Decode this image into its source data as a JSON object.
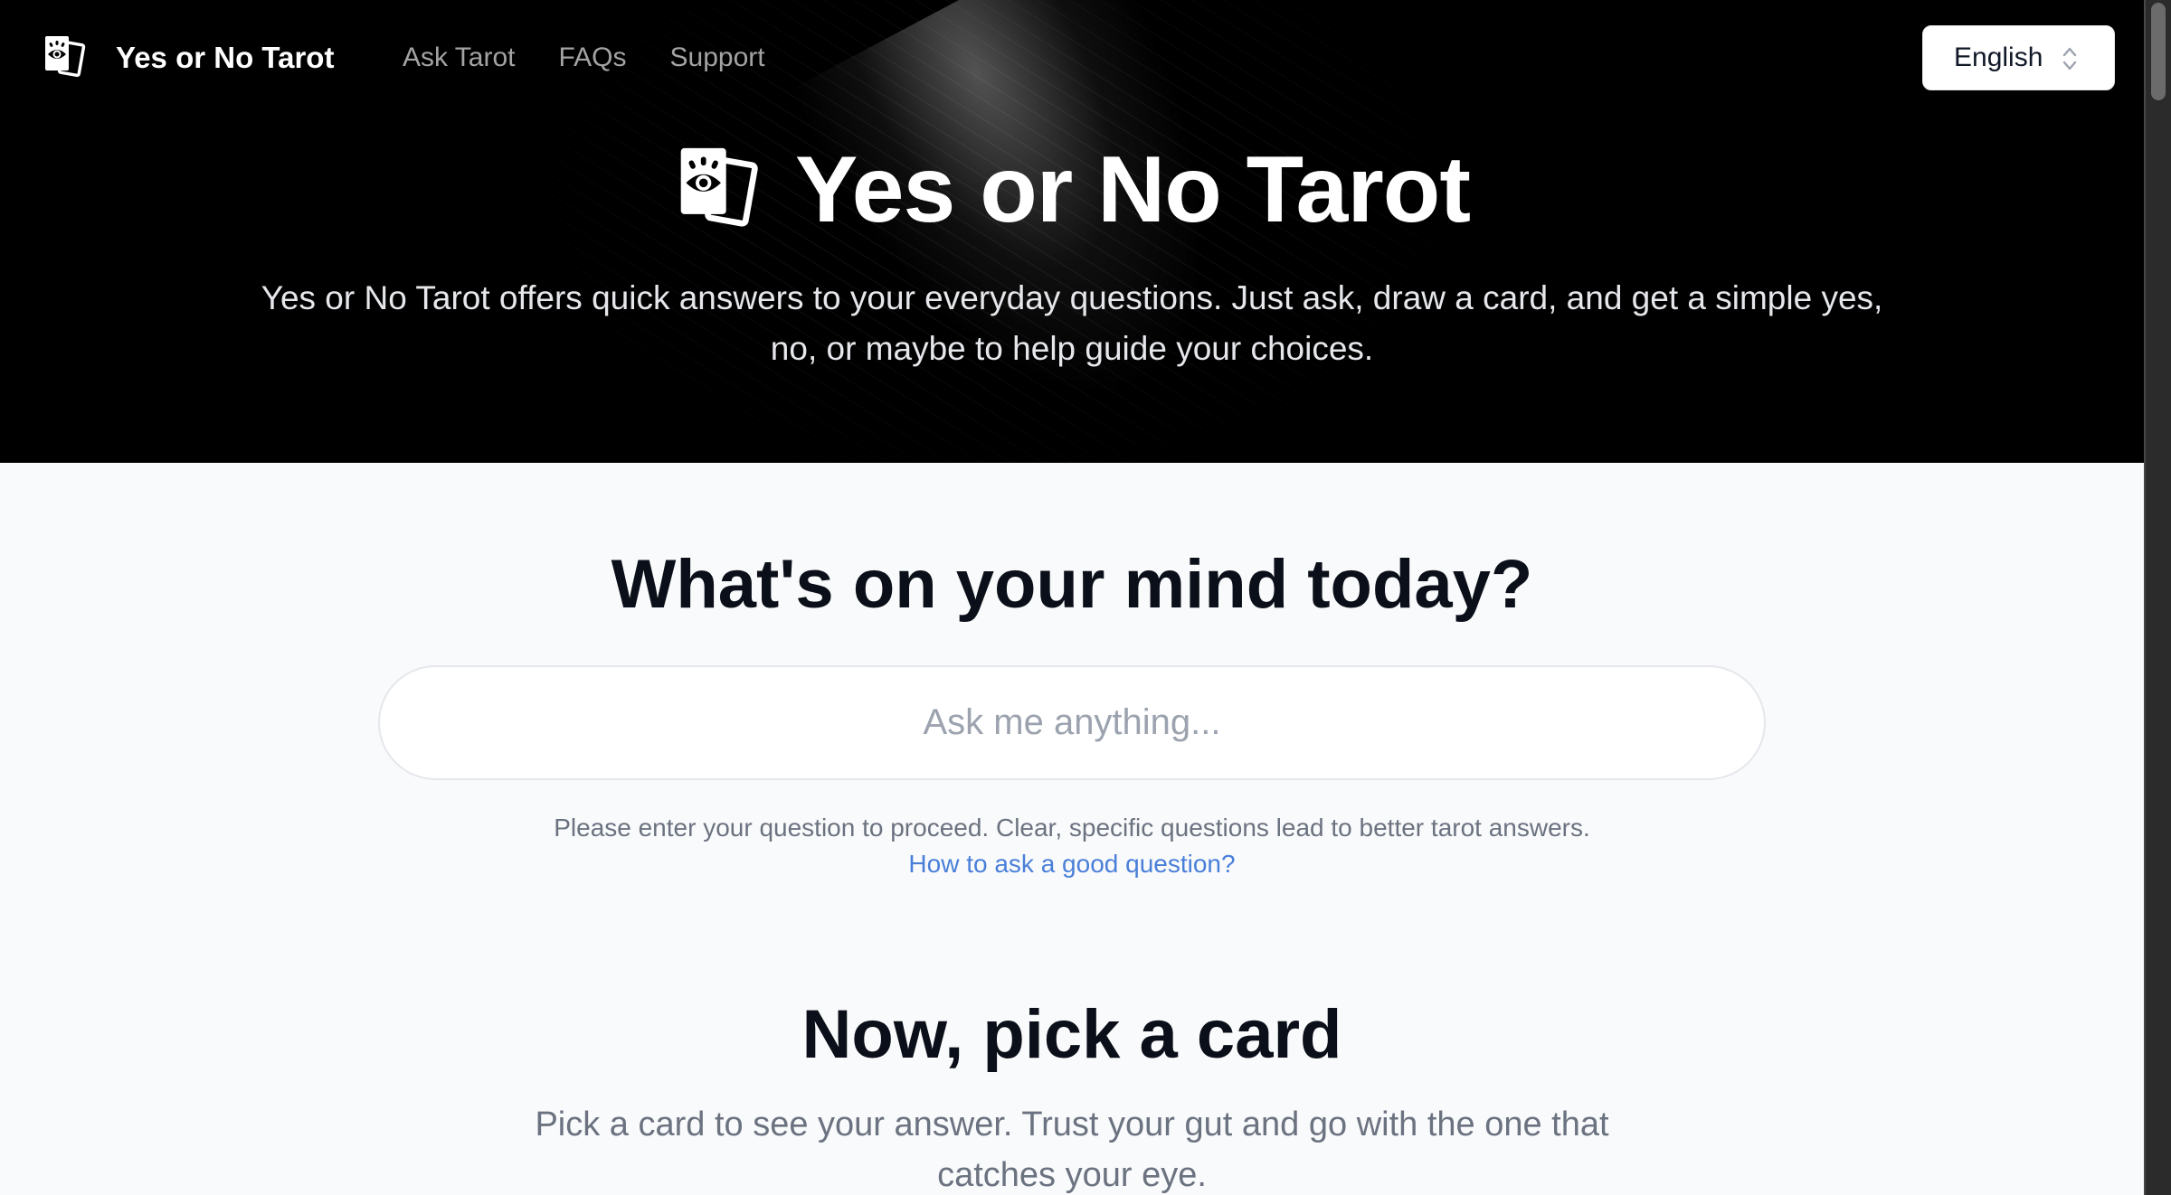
{
  "nav": {
    "brand_name": "Yes or No Tarot",
    "brand_icon": "tarot-cards-eye-icon",
    "links": [
      {
        "label": "Ask Tarot"
      },
      {
        "label": "FAQs"
      },
      {
        "label": "Support"
      }
    ],
    "language": {
      "selected": "English",
      "icon": "chevron-up-down-icon"
    }
  },
  "hero": {
    "title": "Yes or No Tarot",
    "icon": "tarot-cards-eye-icon",
    "subtitle": "Yes or No Tarot offers quick answers to your everyday questions. Just ask, draw a card, and get a simple yes, no, or maybe to help guide your choices."
  },
  "ask": {
    "title": "What's on your mind today?",
    "input_value": "",
    "input_placeholder": "Ask me anything...",
    "helper_text": "Please enter your question to proceed. Clear, specific questions lead to better tarot answers.",
    "helper_link": "How to ask a good question?"
  },
  "pick": {
    "title": "Now, pick a card",
    "subtitle": "Pick a card to see your answer. Trust your gut and go with the one that catches your eye."
  },
  "colors": {
    "hero_bg": "#000000",
    "page_bg": "#f9fafb",
    "heading": "#0b0f19",
    "muted_text": "#6b7280",
    "link": "#4a7fd9",
    "nav_link": "#a3a3a3",
    "placeholder": "#9ca3af"
  }
}
